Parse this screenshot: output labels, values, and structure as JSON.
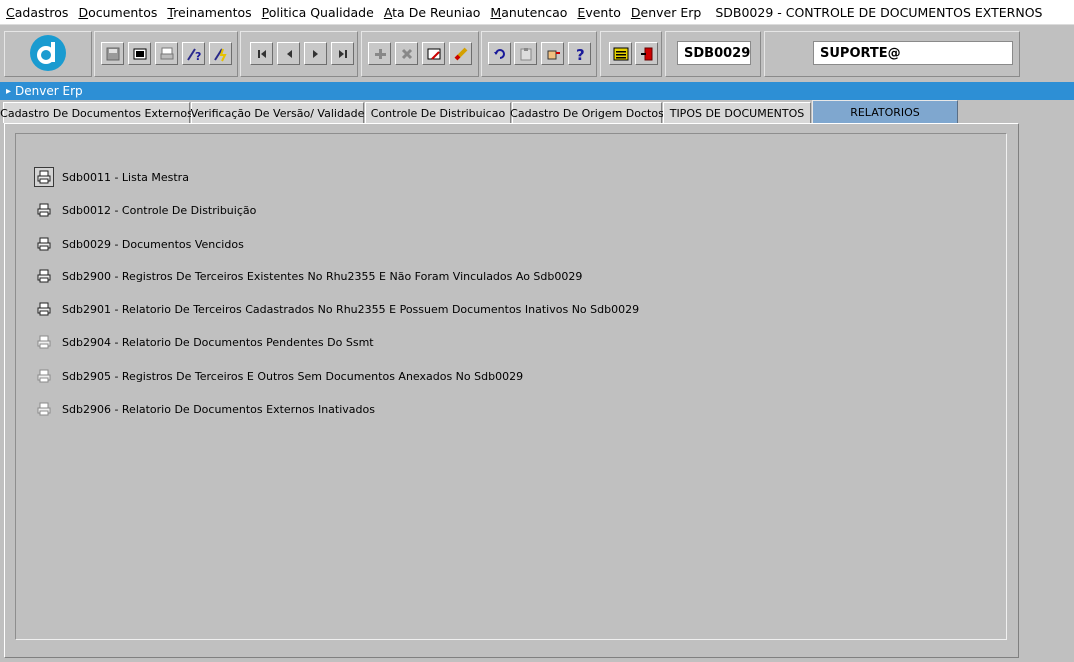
{
  "menu": {
    "items": [
      {
        "first": "C",
        "rest": "adastros"
      },
      {
        "first": "D",
        "rest": "ocumentos"
      },
      {
        "first": "T",
        "rest": "reinamentos"
      },
      {
        "first": "P",
        "rest": "olitica Qualidade"
      },
      {
        "first": "A",
        "rest": "ta De Reuniao"
      },
      {
        "first": "M",
        "rest": "anutencao"
      },
      {
        "first": "E",
        "rest": "vento"
      },
      {
        "first": "D",
        "rest": "enver Erp"
      }
    ],
    "title": "SDB0029 - CONTROLE DE DOCUMENTOS EXTERNOS"
  },
  "toolbar": {
    "form_code": "SDB0029",
    "user": "SUPORTE@",
    "icons": [
      "save-icon",
      "print-screen-icon",
      "print-icon",
      "query-help-icon",
      "execute-query-icon",
      "first-record-icon",
      "previous-record-icon",
      "next-record-icon",
      "last-record-icon",
      "insert-record-icon",
      "delete-record-icon",
      "edit-record-icon",
      "clear-icon",
      "undo-icon",
      "clipboard-icon",
      "hand-icon",
      "help-icon",
      "menu-icon",
      "exit-icon"
    ]
  },
  "window": {
    "title": "Denver Erp"
  },
  "tabs": [
    {
      "label": "Cadastro De Documentos Externos"
    },
    {
      "label": "Verificação De Versão/ Validade"
    },
    {
      "label": "Controle De Distribuicao"
    },
    {
      "label": "Cadastro De Origem Doctos"
    },
    {
      "label": "TIPOS DE DOCUMENTOS"
    },
    {
      "label": "RELATORIOS"
    }
  ],
  "reports": [
    {
      "label": "Sdb0011 - Lista Mestra"
    },
    {
      "label": "Sdb0012 - Controle De Distribuição"
    },
    {
      "label": "Sdb0029 - Documentos Vencidos"
    },
    {
      "label": "Sdb2900 - Registros De Terceiros Existentes No Rhu2355 E Não Foram Vinculados Ao Sdb0029"
    },
    {
      "label": "Sdb2901 - Relatorio De Terceiros Cadastrados No Rhu2355 E Possuem Documentos Inativos No Sdb0029"
    },
    {
      "label": "Sdb2904 - Relatorio De Documentos Pendentes Do Ssmt"
    },
    {
      "label": "Sdb2905 - Registros De Terceiros E Outros Sem Documentos Anexados No Sdb0029"
    },
    {
      "label": "Sdb2906 - Relatorio De Documentos Externos Inativados"
    }
  ],
  "colors": {
    "accent": "#2d8fd5",
    "active_tab": "#7fa7cf",
    "logo": "#1a9bd0"
  }
}
